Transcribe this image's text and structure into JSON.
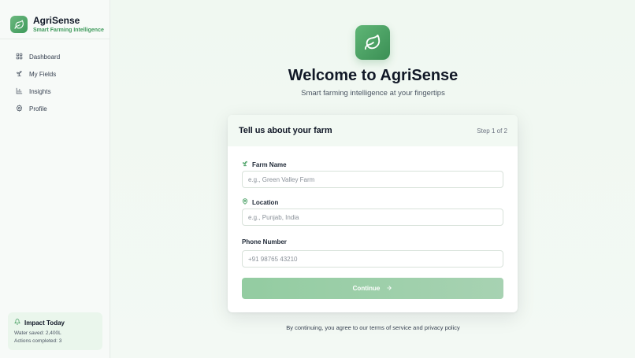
{
  "sidebar": {
    "brand_name": "AgriSense",
    "brand_tagline": "Smart Farming Intelligence",
    "items": [
      {
        "label": "Dashboard",
        "icon": "grid-icon"
      },
      {
        "label": "My Fields",
        "icon": "sprout-icon"
      },
      {
        "label": "Insights",
        "icon": "bar-chart-icon"
      },
      {
        "label": "Profile",
        "icon": "gear-icon"
      }
    ],
    "impact": {
      "title": "Impact Today",
      "water_saved": "Water saved: 2,400L",
      "actions_completed": "Actions completed: 3"
    }
  },
  "hero": {
    "title": "Welcome to AgriSense",
    "subtitle": "Smart farming intelligence at your fingertips"
  },
  "form": {
    "title": "Tell us about your farm",
    "step": "Step 1 of 2",
    "farm_name": {
      "label": "Farm Name",
      "placeholder": "e.g., Green Valley Farm",
      "value": ""
    },
    "location": {
      "label": "Location",
      "placeholder": "e.g., Punjab, India",
      "value": ""
    },
    "phone": {
      "label": "Phone Number",
      "placeholder": "+91 98765 43210",
      "value": ""
    },
    "continue_label": "Continue"
  },
  "footer_note": "By continuing, you agree to our terms of service and privacy policy",
  "colors": {
    "accent": "#3e9a5b",
    "accent_light": "#93cca1",
    "card_header": "#f2f9f3"
  }
}
